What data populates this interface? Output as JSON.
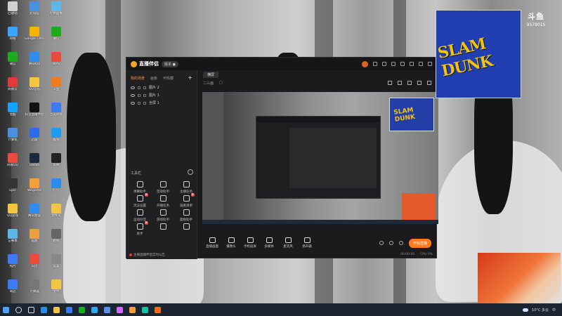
{
  "window": {
    "title": "直播伴侣",
    "version_label": "版本 ●",
    "tabs": [
      "我的场景",
      "画板",
      "可收藏"
    ],
    "add_label": "+",
    "layers": [
      "图片 2",
      "图片 1",
      "全屏 1"
    ],
    "tools_header": "工具栏",
    "tools": [
      {
        "label": "弹幕助手",
        "badge": ""
      },
      {
        "label": "音效助手",
        "badge": ""
      },
      {
        "label": "主播任务",
        "badge": ""
      },
      {
        "label": "玩法设置",
        "badge": "新"
      },
      {
        "label": "开播任务",
        "badge": ""
      },
      {
        "label": "观看清单",
        "badge": "新"
      },
      {
        "label": "运动抖音",
        "badge": ""
      },
      {
        "label": "游戏助手",
        "badge": ""
      },
      {
        "label": "面板助手",
        "badge": ""
      },
      {
        "label": "助手",
        "badge": "新"
      },
      {
        "label": "",
        "badge": ""
      },
      {
        "label": "",
        "badge": ""
      }
    ],
    "notice": "主播直播伴侣实时公告",
    "scene_tab": "横屏",
    "sub_left": [
      "二三画",
      "□"
    ],
    "controls": [
      {
        "label": "直播画面"
      },
      {
        "label": "摄像头"
      },
      {
        "label": "手机投屏"
      },
      {
        "label": "多媒体"
      },
      {
        "label": "麦克风"
      },
      {
        "label": "扬声器"
      }
    ],
    "live_button": "开始直播",
    "timer": "00:00:00",
    "status": "CPU 0%"
  },
  "overlay": {
    "slam_text": "SLAM DUNK",
    "watermark_title": "斗鱼",
    "watermark_sub": "",
    "watermark_id": "9579015"
  },
  "desktop": {
    "icons": [
      "回收站",
      "此电脑",
      "控制面板",
      "网络",
      "Google Chrome",
      "微信",
      "微信",
      "腾讯QQ",
      "WPS",
      "网易云",
      "QQ音乐",
      "斗鱼",
      "优酷",
      "抖音直播伴侣",
      "百度网盘",
      "计算机",
      "迅雷",
      "酷狗",
      "网易UU",
      "Steam",
      "剪映",
      "Epic",
      "Wegame",
      "钉钉",
      "QQ游戏",
      "腾讯会议",
      "文件夹",
      "记事本",
      "画图",
      "相机",
      "照片",
      "日历",
      "设置",
      "商店",
      "计算器",
      "文件"
    ]
  },
  "taskbar": {
    "weather": "10°C 多云",
    "time": "",
    "lang": "中"
  }
}
